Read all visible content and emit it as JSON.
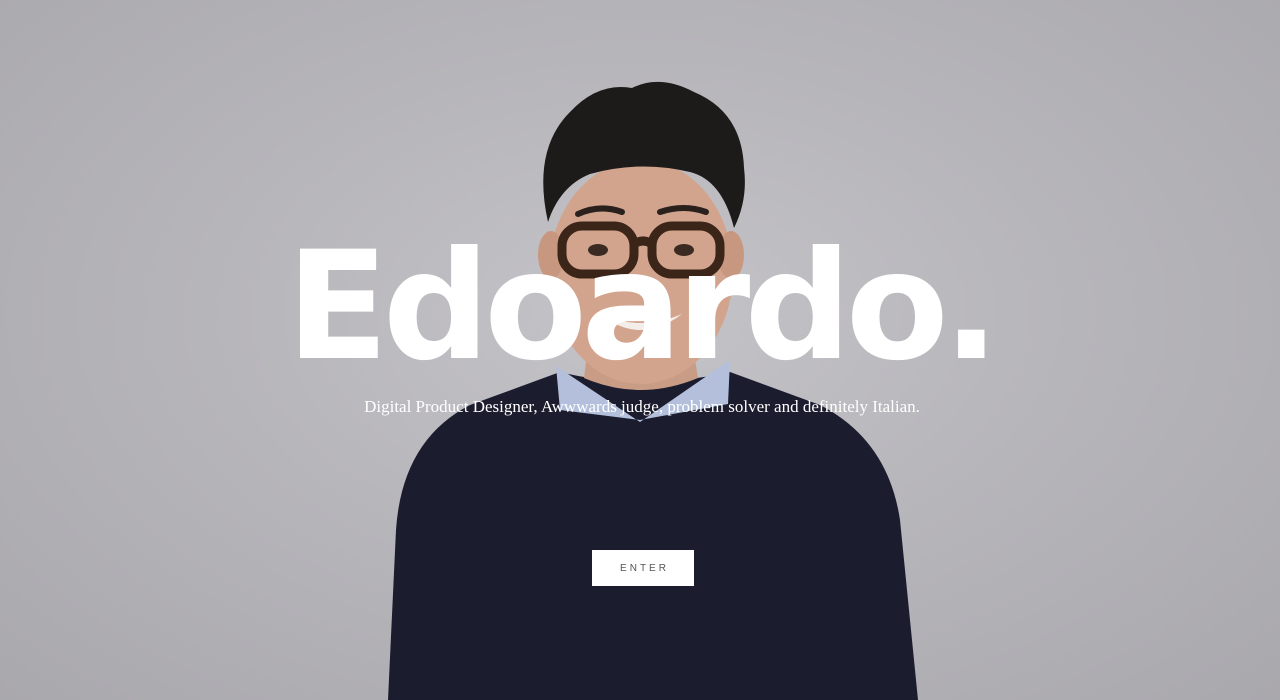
{
  "hero": {
    "title": "Edoardo.",
    "subtitle": "Digital Product Designer, Awwwards judge, problem solver and definitely Italian.",
    "enter_label": "ENTER"
  },
  "colors": {
    "background": "#b7b6bb",
    "text": "#ffffff",
    "sweater": "#1b1c2e",
    "button_background": "#ffffff",
    "button_text": "#555555"
  },
  "background_photo": {
    "subject": "smiling man with glasses, dark hair, navy sweater over light blue collared shirt"
  }
}
